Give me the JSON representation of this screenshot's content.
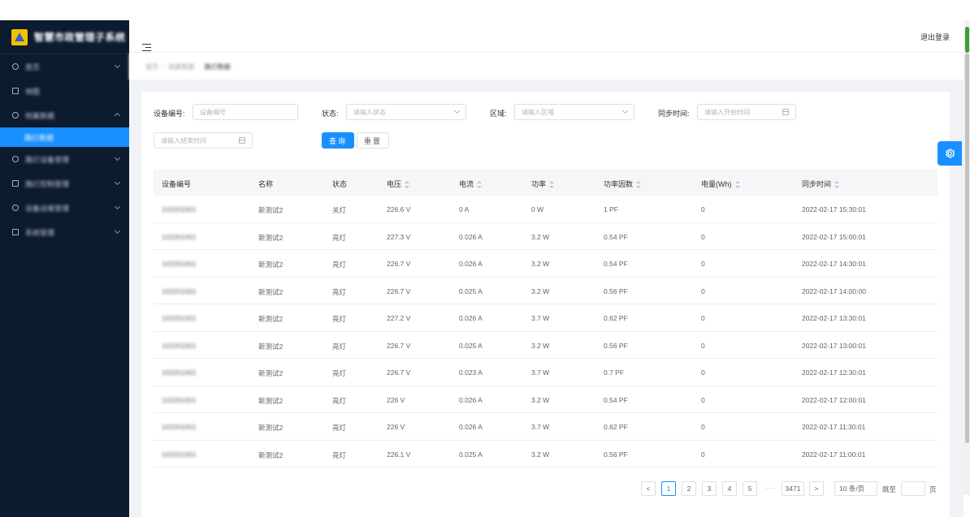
{
  "app": {
    "logo_text": "智慧市政管理子系统"
  },
  "sidebar": {
    "items": [
      {
        "label": "首页",
        "has_arrow": true
      },
      {
        "label": "地图",
        "has_arrow": false
      },
      {
        "label": "档案数据",
        "has_arrow": true,
        "expanded": true
      },
      {
        "label": "路灯数据",
        "sub": true,
        "active": true
      },
      {
        "label": "路灯设备管理",
        "has_arrow": true
      },
      {
        "label": "路灯控制管理",
        "has_arrow": true
      },
      {
        "label": "设备运维管理",
        "has_arrow": true
      },
      {
        "label": "系统管理",
        "has_arrow": true
      }
    ]
  },
  "header": {
    "logout_label": "退出登录"
  },
  "breadcrumb": [
    "首页",
    "档案数据",
    "路灯数据"
  ],
  "filters": {
    "device_label": "设备编号:",
    "device_placeholder": "设备编号",
    "status_label": "状态:",
    "status_placeholder": "请输入状态",
    "area_label": "区域:",
    "area_placeholder": "请输入区域",
    "sync_label": "同步时间:",
    "start_placeholder": "请输入开始时间",
    "end_placeholder": "请输入结束时间",
    "search_button": "查询",
    "reset_button": "重置"
  },
  "table": {
    "columns": [
      "设备编号",
      "名称",
      "状态",
      "电压",
      "电流",
      "功率",
      "功率因数",
      "电量(Wh)",
      "同步时间"
    ],
    "rows": [
      [
        "102201001",
        "新测试2",
        "关灯",
        "226.6 V",
        "0 A",
        "0 W",
        "1 PF",
        "0",
        "2022-02-17 15:30:01"
      ],
      [
        "102201001",
        "新测试2",
        "亮灯",
        "227.3 V",
        "0.026 A",
        "3.2 W",
        "0.54 PF",
        "0",
        "2022-02-17 15:00:01"
      ],
      [
        "102201001",
        "新测试2",
        "亮灯",
        "226.7 V",
        "0.026 A",
        "3.2 W",
        "0.54 PF",
        "0",
        "2022-02-17 14:30:01"
      ],
      [
        "102201001",
        "新测试2",
        "亮灯",
        "226.7 V",
        "0.025 A",
        "3.2 W",
        "0.56 PF",
        "0",
        "2022-02-17 14:00:00"
      ],
      [
        "102201001",
        "新测试2",
        "亮灯",
        "227.2 V",
        "0.026 A",
        "3.7 W",
        "0.62 PF",
        "0",
        "2022-02-17 13:30:01"
      ],
      [
        "102201001",
        "新测试2",
        "亮灯",
        "226.7 V",
        "0.025 A",
        "3.2 W",
        "0.56 PF",
        "0",
        "2022-02-17 13:00:01"
      ],
      [
        "102201001",
        "新测试2",
        "亮灯",
        "226.7 V",
        "0.023 A",
        "3.7 W",
        "0.7 PF",
        "0",
        "2022-02-17 12:30:01"
      ],
      [
        "102201001",
        "新测试2",
        "亮灯",
        "226 V",
        "0.026 A",
        "3.2 W",
        "0.54 PF",
        "0",
        "2022-02-17 12:00:01"
      ],
      [
        "102201001",
        "新测试2",
        "亮灯",
        "226 V",
        "0.026 A",
        "3.7 W",
        "0.62 PF",
        "0",
        "2022-02-17 11:30:01"
      ],
      [
        "102201001",
        "新测试2",
        "亮灯",
        "226.1 V",
        "0.025 A",
        "3.2 W",
        "0.56 PF",
        "0",
        "2022-02-17 11:00:01"
      ]
    ]
  },
  "pagination": {
    "prev": "<",
    "pages": [
      "1",
      "2",
      "3",
      "4",
      "5"
    ],
    "ellipsis": "···",
    "last_page": "3471",
    "next": ">",
    "page_size": "10 条/页",
    "jump_label": "跳至",
    "page_suffix": "页",
    "current_page": 1
  },
  "colors": {
    "sidebar_bg": "#0d1b2f",
    "accent": "#1890ff"
  }
}
